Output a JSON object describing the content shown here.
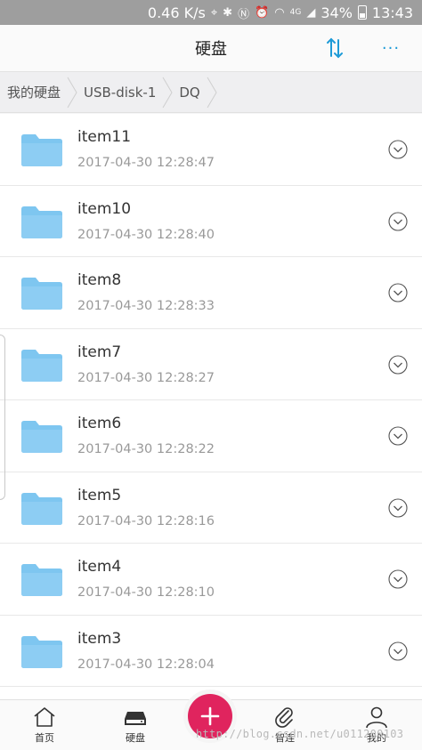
{
  "status_bar": {
    "speed": "0.46 K/s",
    "signal_label": "4G",
    "battery": "34%",
    "time": "13:43"
  },
  "header": {
    "title": "硬盘"
  },
  "breadcrumb": [
    "我的硬盘",
    "USB-disk-1",
    "DQ"
  ],
  "files": [
    {
      "name": "item11",
      "date": "2017-04-30 12:28:47"
    },
    {
      "name": "item10",
      "date": "2017-04-30 12:28:40"
    },
    {
      "name": "item8",
      "date": "2017-04-30 12:28:33"
    },
    {
      "name": "item7",
      "date": "2017-04-30 12:28:27"
    },
    {
      "name": "item6",
      "date": "2017-04-30 12:28:22"
    },
    {
      "name": "item5",
      "date": "2017-04-30 12:28:16"
    },
    {
      "name": "item4",
      "date": "2017-04-30 12:28:10"
    },
    {
      "name": "item3",
      "date": "2017-04-30 12:28:04"
    }
  ],
  "bottom_nav": [
    {
      "label": "首页",
      "icon": "home-icon"
    },
    {
      "label": "硬盘",
      "icon": "hard-disk-icon"
    },
    {
      "label": "智连",
      "icon": "paperclip-icon"
    },
    {
      "label": "我的",
      "icon": "user-icon"
    }
  ],
  "fab": {
    "icon": "plus-icon"
  },
  "watermark": "http://blog.csdn.net/u011200103",
  "colors": {
    "accent": "#1e9bd7",
    "folder": "#7ec6f0",
    "fab": "#e0245e"
  }
}
